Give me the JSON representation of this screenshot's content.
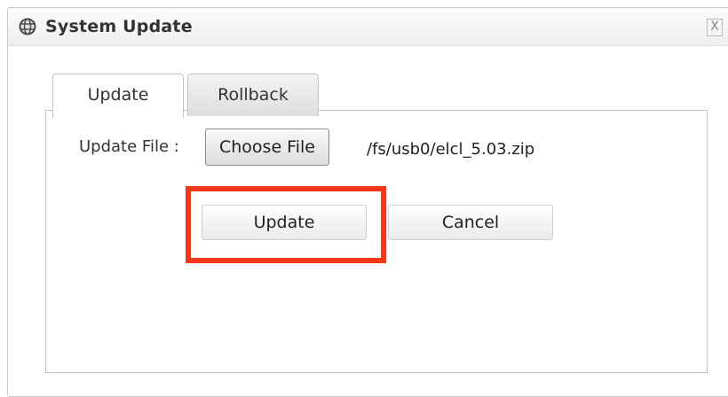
{
  "window": {
    "title": "System Update",
    "close_label": "X"
  },
  "tabs": [
    {
      "label": "Update",
      "active": true
    },
    {
      "label": "Rollback",
      "active": false
    }
  ],
  "form": {
    "file_label": "Update File :",
    "choose_file_label": "Choose File",
    "selected_file": "/fs/usb0/elcl_5.03.zip"
  },
  "actions": {
    "update_label": "Update",
    "cancel_label": "Cancel"
  },
  "colors": {
    "highlight": "#f4361b"
  }
}
